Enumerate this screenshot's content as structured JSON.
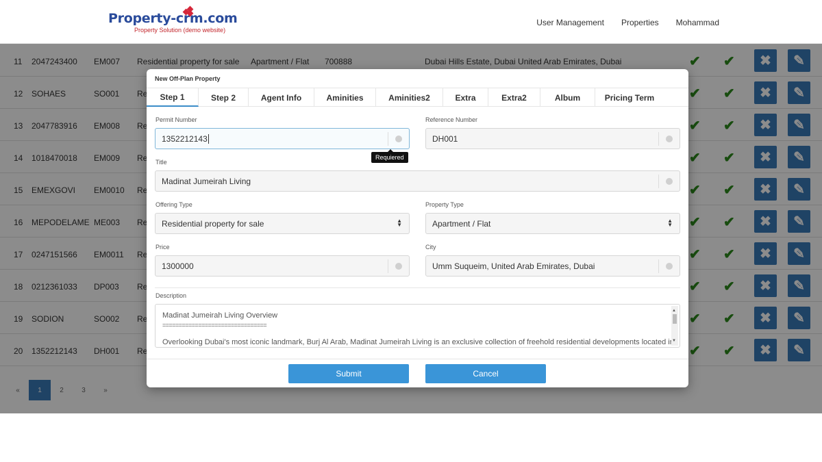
{
  "header": {
    "logo_text": "Property-crm.com",
    "logo_subtitle": "Property Solution (demo website)",
    "nav": [
      "User Management",
      "Properties",
      "Mohammad"
    ]
  },
  "table": {
    "rows": [
      {
        "no": "11",
        "phone": "2047243400",
        "code": "EM007",
        "offering": "Residential property for sale",
        "type": "Apartment / Flat",
        "price": "700888",
        "location": "Dubai Hills Estate, Dubai United Arab Emirates, Dubai"
      },
      {
        "no": "12",
        "phone": "SOHAES",
        "code": "SO001",
        "offering": "Re"
      },
      {
        "no": "13",
        "phone": "2047783916",
        "code": "EM008",
        "offering": "Re"
      },
      {
        "no": "14",
        "phone": "1018470018",
        "code": "EM009",
        "offering": "Re"
      },
      {
        "no": "15",
        "phone": "EMEXGOVI",
        "code": "EM0010",
        "offering": "Re"
      },
      {
        "no": "16",
        "phone": "MEPODELAME",
        "code": "ME003",
        "offering": "Re"
      },
      {
        "no": "17",
        "phone": "0247151566",
        "code": "EM0011",
        "offering": "Re"
      },
      {
        "no": "18",
        "phone": "0212361033",
        "code": "DP003",
        "offering": "Re"
      },
      {
        "no": "19",
        "phone": "SODION",
        "code": "SO002",
        "offering": "Re"
      },
      {
        "no": "20",
        "phone": "1352212143",
        "code": "DH001",
        "offering": "Re"
      }
    ],
    "check_icon": "check-icon",
    "delete_icon": "x-icon",
    "edit_icon": "pencil-icon",
    "pagination": [
      "«",
      "1",
      "2",
      "3",
      "»"
    ],
    "active_page": "1"
  },
  "modal": {
    "title": "New Off-Plan Property",
    "tabs": [
      "Step 1",
      "Step 2",
      "Agent Info",
      "Aminities",
      "Aminities2",
      "Extra",
      "Extra2",
      "Album",
      "Pricing Term"
    ],
    "active_tab": "Step 1",
    "fields": {
      "permit_number": {
        "label": "Permit Number",
        "value": "1352212143",
        "tooltip": "Requiered"
      },
      "reference_number": {
        "label": "Reference Number",
        "value": "DH001"
      },
      "title": {
        "label": "Title",
        "value": "Madinat Jumeirah Living"
      },
      "offering_type": {
        "label": "Offering Type",
        "value": "Residential property for sale"
      },
      "property_type": {
        "label": "Property Type",
        "value": "Apartment / Flat"
      },
      "price": {
        "label": "Price",
        "value": "1300000"
      },
      "city": {
        "label": "City",
        "value": "Umm Suqueim, United Arab Emirates, Dubai"
      },
      "description": {
        "label": "Description",
        "line1": "Madinat Jumeirah Living Overview",
        "line2": "================================",
        "line3": "Overlooking Dubai's most iconic landmark, Burj Al Arab, Madinat Jumeirah Living is an exclusive collection of freehold residential developments located in"
      }
    },
    "buttons": {
      "submit": "Submit",
      "cancel": "Cancel"
    }
  },
  "colors": {
    "accent": "#3a95d8",
    "check": "#2c8a1c",
    "action_button": "#3a7ab8",
    "brand": "#2a4b9b"
  }
}
